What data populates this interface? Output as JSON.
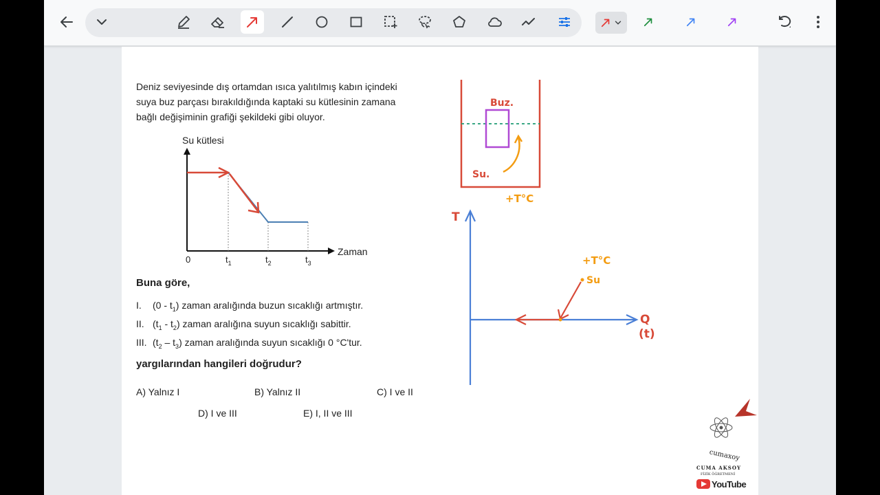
{
  "toolbar": {
    "back_icon": "arrow-left-icon",
    "collapse_icon": "chevron-down-icon",
    "tools": [
      "pen-icon",
      "eraser-icon",
      "arrow-tool-icon",
      "line-icon",
      "circle-icon",
      "rectangle-icon",
      "selection-icon",
      "lasso-icon",
      "pentagon-icon",
      "cloud-icon",
      "scribble-icon",
      "settings-sliders-icon"
    ],
    "active_tool": "arrow-tool-icon",
    "colors": [
      "#e53935",
      "#1e8e3e",
      "#4285f4",
      "#a142f4"
    ],
    "selected_color": "#e53935",
    "undo_icon": "undo-icon",
    "more_icon": "more-vert-icon"
  },
  "question": {
    "intro_line1": "Deniz seviyesinde dış ortamdan ısıca yalıtılmış kabın içindeki",
    "intro_line2": "suya buz parçası bırakıldığında kaptaki su kütlesinin zamana",
    "intro_line3": "bağlı değişiminin grafiği şekildeki gibi oluyor.",
    "lead": "Buna göre,",
    "statements": [
      {
        "num": "I.",
        "pre": "(0 - t",
        "sub1": "1",
        "post": ") zaman aralığında buzun sıcaklığı artmıştır."
      },
      {
        "num": "II.",
        "pre": "(t",
        "sub1": "1",
        "mid": " - t",
        "sub2": "2",
        "post": ") zaman aralığına suyun sıcaklığı sabittir."
      },
      {
        "num": "III.",
        "pre": "(t",
        "sub1": "2",
        "mid": " – t",
        "sub2": "3",
        "post": ") zaman aralığında suyun  sıcaklığı 0 °C'tur."
      }
    ],
    "ask": "yargılarından hangileri doğrudur?",
    "options": [
      "A) Yalnız I",
      "B) Yalnız II",
      "C) I ve II",
      "D) I ve III",
      "E) I, II ve III"
    ]
  },
  "graph": {
    "ylabel": "Su kütlesi",
    "xlabel": "Zaman",
    "origin": "0",
    "ticks": [
      {
        "t": "t",
        "s": "1"
      },
      {
        "t": "t",
        "s": "2"
      },
      {
        "t": "t",
        "s": "3"
      }
    ]
  },
  "annotations": {
    "buz": "Buz.",
    "su": "Su.",
    "temp1": "+T°C",
    "t_axis": "T",
    "temp2": "+T°C",
    "su2": "Su",
    "q_label": "Q",
    "t_label": "(t)"
  },
  "logo": {
    "arc_text": "cumaxoy",
    "name": "CUMA AKSOY",
    "title": "FİZİK ÖĞRETMENİ",
    "youtube": "YouTube"
  }
}
